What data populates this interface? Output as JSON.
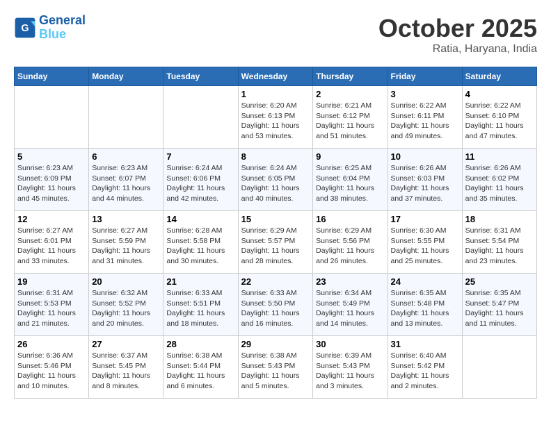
{
  "header": {
    "logo_line1": "General",
    "logo_line2": "Blue",
    "month": "October 2025",
    "location": "Ratia, Haryana, India"
  },
  "days_of_week": [
    "Sunday",
    "Monday",
    "Tuesday",
    "Wednesday",
    "Thursday",
    "Friday",
    "Saturday"
  ],
  "weeks": [
    [
      {
        "day": "",
        "detail": ""
      },
      {
        "day": "",
        "detail": ""
      },
      {
        "day": "",
        "detail": ""
      },
      {
        "day": "1",
        "detail": "Sunrise: 6:20 AM\nSunset: 6:13 PM\nDaylight: 11 hours\nand 53 minutes."
      },
      {
        "day": "2",
        "detail": "Sunrise: 6:21 AM\nSunset: 6:12 PM\nDaylight: 11 hours\nand 51 minutes."
      },
      {
        "day": "3",
        "detail": "Sunrise: 6:22 AM\nSunset: 6:11 PM\nDaylight: 11 hours\nand 49 minutes."
      },
      {
        "day": "4",
        "detail": "Sunrise: 6:22 AM\nSunset: 6:10 PM\nDaylight: 11 hours\nand 47 minutes."
      }
    ],
    [
      {
        "day": "5",
        "detail": "Sunrise: 6:23 AM\nSunset: 6:09 PM\nDaylight: 11 hours\nand 45 minutes."
      },
      {
        "day": "6",
        "detail": "Sunrise: 6:23 AM\nSunset: 6:07 PM\nDaylight: 11 hours\nand 44 minutes."
      },
      {
        "day": "7",
        "detail": "Sunrise: 6:24 AM\nSunset: 6:06 PM\nDaylight: 11 hours\nand 42 minutes."
      },
      {
        "day": "8",
        "detail": "Sunrise: 6:24 AM\nSunset: 6:05 PM\nDaylight: 11 hours\nand 40 minutes."
      },
      {
        "day": "9",
        "detail": "Sunrise: 6:25 AM\nSunset: 6:04 PM\nDaylight: 11 hours\nand 38 minutes."
      },
      {
        "day": "10",
        "detail": "Sunrise: 6:26 AM\nSunset: 6:03 PM\nDaylight: 11 hours\nand 37 minutes."
      },
      {
        "day": "11",
        "detail": "Sunrise: 6:26 AM\nSunset: 6:02 PM\nDaylight: 11 hours\nand 35 minutes."
      }
    ],
    [
      {
        "day": "12",
        "detail": "Sunrise: 6:27 AM\nSunset: 6:01 PM\nDaylight: 11 hours\nand 33 minutes."
      },
      {
        "day": "13",
        "detail": "Sunrise: 6:27 AM\nSunset: 5:59 PM\nDaylight: 11 hours\nand 31 minutes."
      },
      {
        "day": "14",
        "detail": "Sunrise: 6:28 AM\nSunset: 5:58 PM\nDaylight: 11 hours\nand 30 minutes."
      },
      {
        "day": "15",
        "detail": "Sunrise: 6:29 AM\nSunset: 5:57 PM\nDaylight: 11 hours\nand 28 minutes."
      },
      {
        "day": "16",
        "detail": "Sunrise: 6:29 AM\nSunset: 5:56 PM\nDaylight: 11 hours\nand 26 minutes."
      },
      {
        "day": "17",
        "detail": "Sunrise: 6:30 AM\nSunset: 5:55 PM\nDaylight: 11 hours\nand 25 minutes."
      },
      {
        "day": "18",
        "detail": "Sunrise: 6:31 AM\nSunset: 5:54 PM\nDaylight: 11 hours\nand 23 minutes."
      }
    ],
    [
      {
        "day": "19",
        "detail": "Sunrise: 6:31 AM\nSunset: 5:53 PM\nDaylight: 11 hours\nand 21 minutes."
      },
      {
        "day": "20",
        "detail": "Sunrise: 6:32 AM\nSunset: 5:52 PM\nDaylight: 11 hours\nand 20 minutes."
      },
      {
        "day": "21",
        "detail": "Sunrise: 6:33 AM\nSunset: 5:51 PM\nDaylight: 11 hours\nand 18 minutes."
      },
      {
        "day": "22",
        "detail": "Sunrise: 6:33 AM\nSunset: 5:50 PM\nDaylight: 11 hours\nand 16 minutes."
      },
      {
        "day": "23",
        "detail": "Sunrise: 6:34 AM\nSunset: 5:49 PM\nDaylight: 11 hours\nand 14 minutes."
      },
      {
        "day": "24",
        "detail": "Sunrise: 6:35 AM\nSunset: 5:48 PM\nDaylight: 11 hours\nand 13 minutes."
      },
      {
        "day": "25",
        "detail": "Sunrise: 6:35 AM\nSunset: 5:47 PM\nDaylight: 11 hours\nand 11 minutes."
      }
    ],
    [
      {
        "day": "26",
        "detail": "Sunrise: 6:36 AM\nSunset: 5:46 PM\nDaylight: 11 hours\nand 10 minutes."
      },
      {
        "day": "27",
        "detail": "Sunrise: 6:37 AM\nSunset: 5:45 PM\nDaylight: 11 hours\nand 8 minutes."
      },
      {
        "day": "28",
        "detail": "Sunrise: 6:38 AM\nSunset: 5:44 PM\nDaylight: 11 hours\nand 6 minutes."
      },
      {
        "day": "29",
        "detail": "Sunrise: 6:38 AM\nSunset: 5:43 PM\nDaylight: 11 hours\nand 5 minutes."
      },
      {
        "day": "30",
        "detail": "Sunrise: 6:39 AM\nSunset: 5:43 PM\nDaylight: 11 hours\nand 3 minutes."
      },
      {
        "day": "31",
        "detail": "Sunrise: 6:40 AM\nSunset: 5:42 PM\nDaylight: 11 hours\nand 2 minutes."
      },
      {
        "day": "",
        "detail": ""
      }
    ]
  ]
}
